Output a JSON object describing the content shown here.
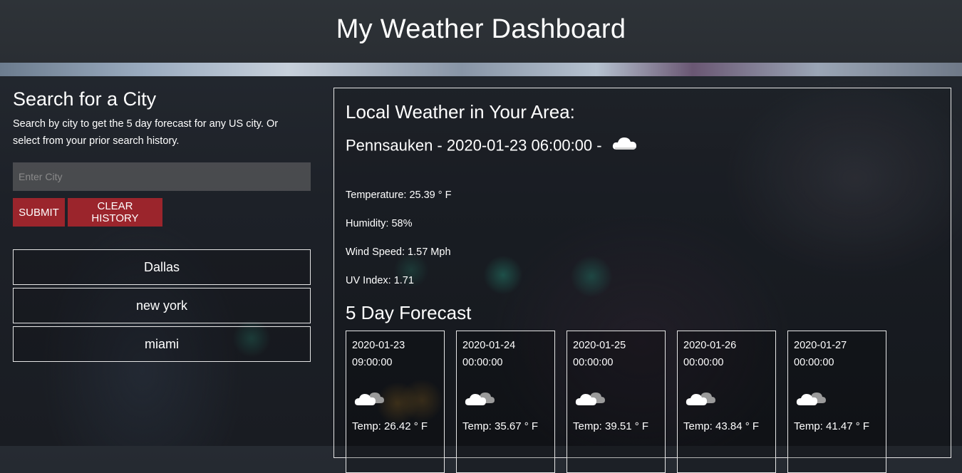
{
  "header": {
    "title": "My Weather Dashboard"
  },
  "search": {
    "heading": "Search for a City",
    "description": "Search by city to get the 5 day forecast for any US city. Or select from your prior search history.",
    "input_placeholder": "Enter City",
    "input_value": "",
    "submit_label": "SUBMIT",
    "clear_label": "CLEAR HISTORY"
  },
  "history": [
    "Dallas",
    "new york",
    "miami"
  ],
  "current": {
    "heading": "Local Weather in Your Area:",
    "title": "Pennsauken - 2020-01-23 06:00:00 -",
    "icon": "cloud-icon",
    "temperature": "Temperature: 25.39 ° F",
    "humidity": "Humidity: 58%",
    "wind": "Wind Speed: 1.57 Mph",
    "uv": "UV Index: 1.71"
  },
  "forecast": {
    "heading": "5 Day Forecast",
    "days": [
      {
        "date": "2020-01-23 09:00:00",
        "icon": "partly-cloudy-icon",
        "temp": "Temp: 26.42 ° F"
      },
      {
        "date": "2020-01-24 00:00:00",
        "icon": "partly-cloudy-icon",
        "temp": "Temp: 35.67 ° F"
      },
      {
        "date": "2020-01-25 00:00:00",
        "icon": "partly-cloudy-icon",
        "temp": "Temp: 39.51 ° F"
      },
      {
        "date": "2020-01-26 00:00:00",
        "icon": "partly-cloudy-icon",
        "temp": "Temp: 43.84 ° F"
      },
      {
        "date": "2020-01-27 00:00:00",
        "icon": "partly-cloudy-icon",
        "temp": "Temp: 41.47 ° F"
      }
    ]
  },
  "colors": {
    "button": "#9b252c",
    "border": "#e6e6e6",
    "header_bg": "#2e3338"
  }
}
